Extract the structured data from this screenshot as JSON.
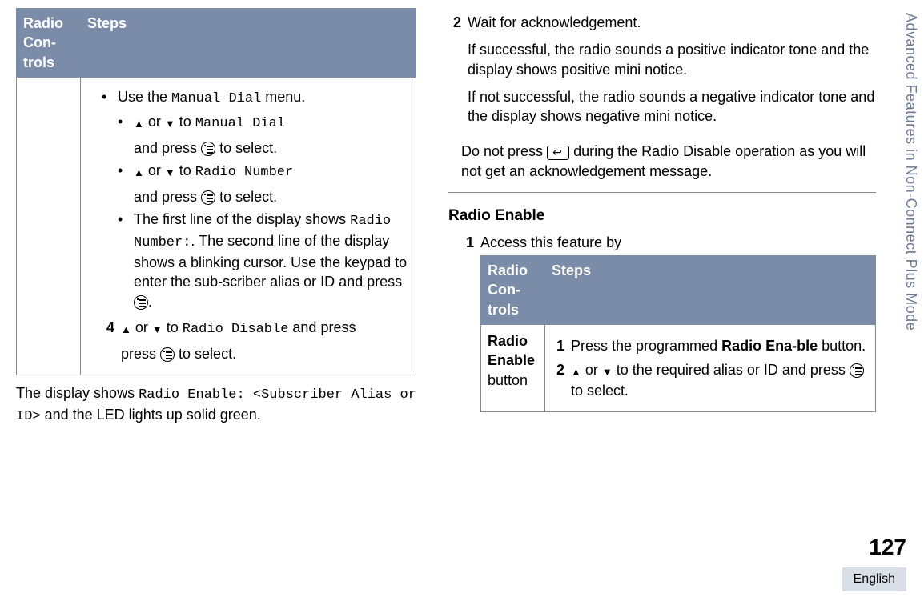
{
  "side_tab": "Advanced Features in Non-Connect Plus Mode",
  "page_number": "127",
  "language": "English",
  "left": {
    "table": {
      "col1": "Radio Con-trols",
      "col2": "Steps",
      "bullet1_pre": "Use the ",
      "bullet1_mono": "Manual Dial",
      "bullet1_post": " menu.",
      "sub1_or": " or ",
      "sub1_to": " to ",
      "sub1_mono": "Manual Dial",
      "sub_press": "and press ",
      "sub_select": " to select.",
      "sub2_mono": "Radio Number",
      "bullet3a": "The first line of the display shows ",
      "bullet3_mono": "Radio Number:",
      "bullet3b": ". The second line of the display shows a blinking cursor. Use the keypad to enter the sub-scriber alias or ID and press ",
      "bullet3_dot": ".",
      "step4_n": "4",
      "step4_or": " or ",
      "step4_to": " to ",
      "step4_mono": "Radio Disable",
      "step4_and": " and press ",
      "step4_sel": " to select."
    },
    "below_a": "The display shows ",
    "below_mono": "Radio Enable: <Subscriber Alias or ID>",
    "below_b": " and the LED lights up solid green."
  },
  "right": {
    "s2_n": "2",
    "s2_txt": "Wait for acknowledgement.",
    "s2_p1": "If successful, the radio sounds a positive indicator tone and the display shows positive mini notice.",
    "s2_p2": "If not successful, the radio sounds a negative indicator tone and the display shows negative mini notice.",
    "s2_p3a": "Do not press ",
    "s2_p3b": " during the Radio Disable operation as you will not get an acknowledgement message.",
    "heading": "Radio Enable",
    "s1_n": "1",
    "s1_txt": "Access this feature by",
    "table": {
      "col1": "Radio Con-trols",
      "col2": "Steps",
      "row_label_a": "Radio Enable",
      "row_label_b": " button",
      "r1_n": "1",
      "r1_a": "Press the programmed ",
      "r1_b": "Radio Ena-ble",
      "r1_c": " button.",
      "r2_n": "2",
      "r2_or": " or ",
      "r2_to": " to the required alias or ID and press ",
      "r2_sel": " to select."
    }
  }
}
